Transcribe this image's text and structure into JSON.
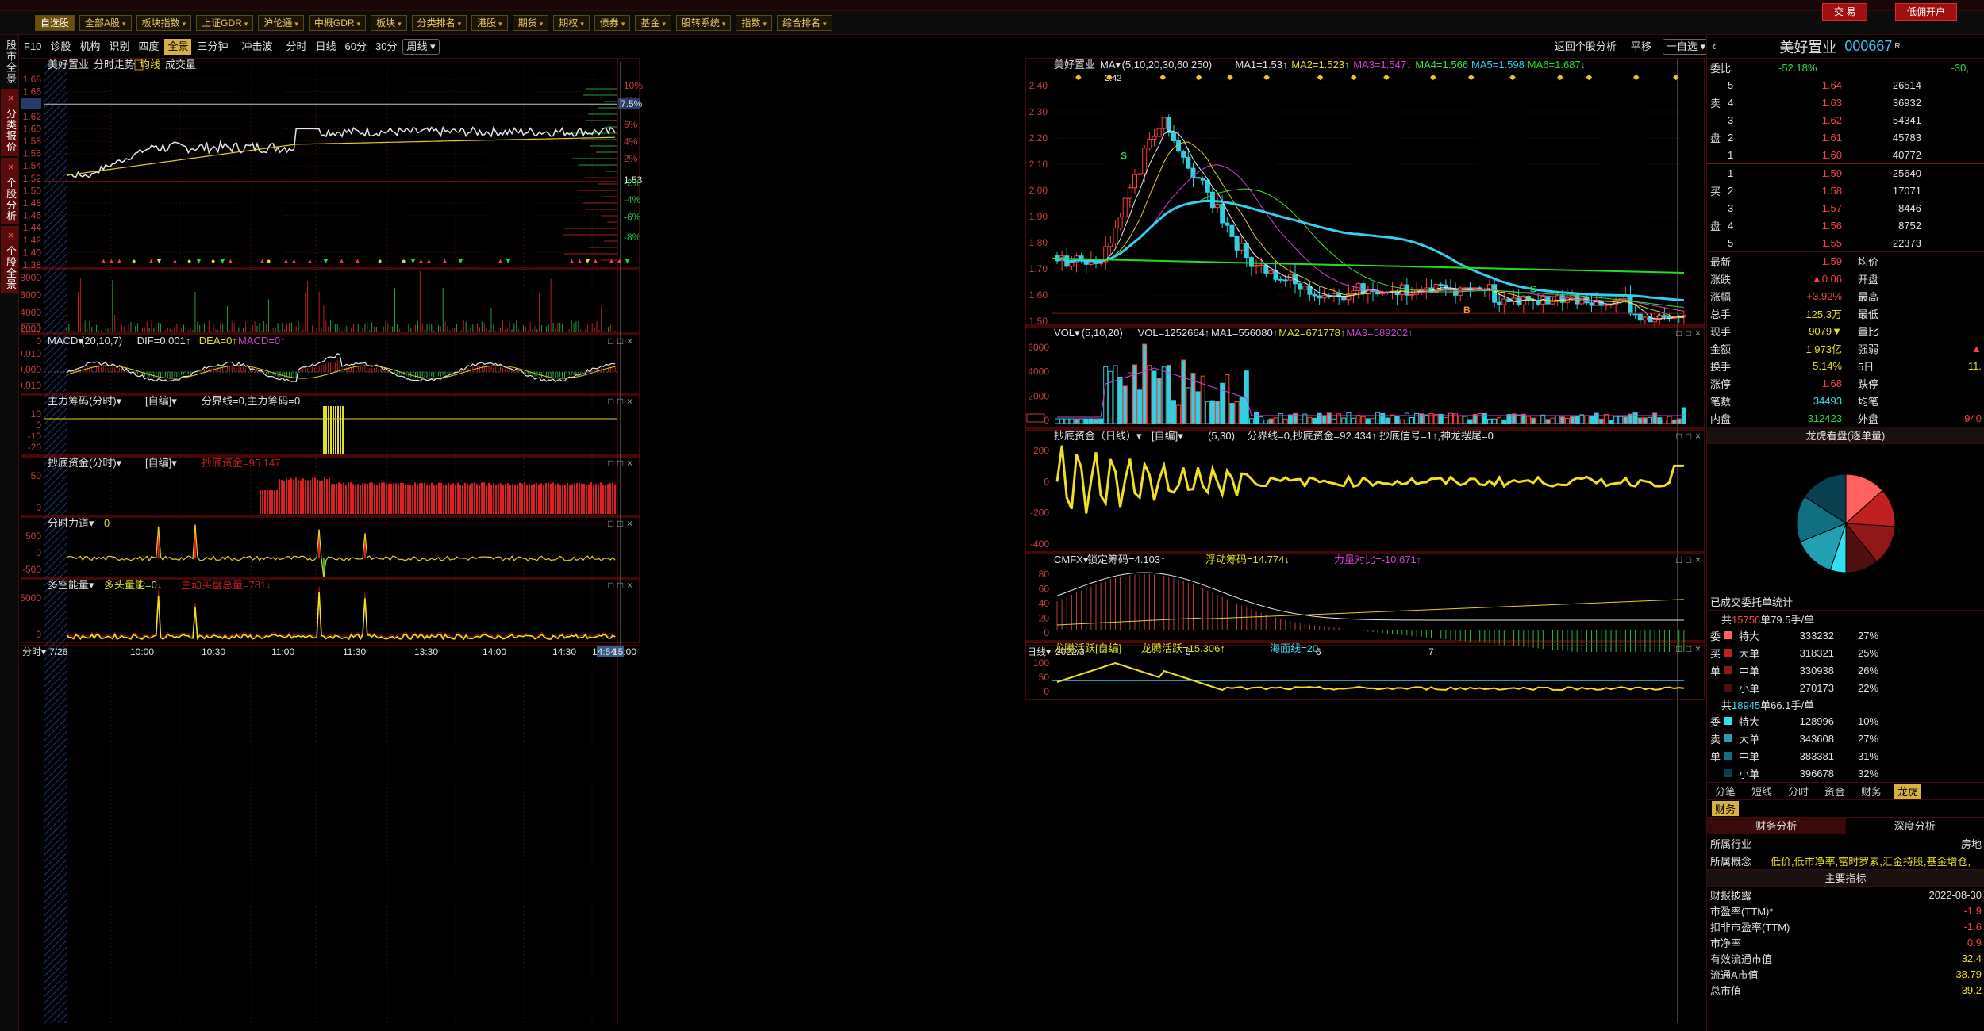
{
  "toolbar": {
    "buttons": [
      {
        "label": "自选股",
        "active": true
      },
      {
        "label": "全部A股",
        "dd": true
      },
      {
        "label": "板块指数",
        "dd": true
      },
      {
        "label": "上证GDR",
        "dd": true
      },
      {
        "label": "沪伦通",
        "dd": true
      },
      {
        "label": "中概GDR",
        "dd": true
      },
      {
        "label": "板块",
        "dd": true
      },
      {
        "label": "分类排名",
        "dd": true
      },
      {
        "label": "港股",
        "dd": true
      },
      {
        "label": "期货",
        "dd": true
      },
      {
        "label": "期权",
        "dd": true
      },
      {
        "label": "债券",
        "dd": true
      },
      {
        "label": "基金",
        "dd": true
      },
      {
        "label": "股转系统",
        "dd": true
      },
      {
        "label": "指数",
        "dd": true
      },
      {
        "label": "综合排名",
        "dd": true
      }
    ],
    "trade_button": "交 易",
    "open_account_button": "低佣开户"
  },
  "sidebar": {
    "tabs": [
      {
        "label": "股市全景",
        "active": false
      },
      {
        "label": "分类报价",
        "active": true
      },
      {
        "label": "个股分析",
        "active": true
      },
      {
        "label": "个股全景",
        "active": true
      }
    ]
  },
  "subbar": {
    "left": [
      "F10",
      "诊股",
      "机构",
      "识别",
      "四度",
      "全景",
      "三分钟",
      "冲击波",
      "分时",
      "日线",
      "60分",
      "30分",
      "周线"
    ],
    "active": "全景",
    "right": [
      "返回个股分析",
      "平移",
      "一自选"
    ]
  },
  "intraday": {
    "header": {
      "name": "美好置业",
      "t1": "分时走势",
      "t2": "均线",
      "t3": "成交量"
    },
    "price_ticks": [
      "1.68",
      "1.66",
      "1.64",
      "1.62",
      "1.60",
      "1.58",
      "1.56",
      "1.54",
      "1.52",
      "1.50",
      "1.48",
      "1.46",
      "1.44",
      "1.42",
      "1.40",
      "1.38"
    ],
    "pct_ticks": [
      "10%",
      "8%",
      "6%",
      "4%",
      "2%",
      "-2%",
      "-4%",
      "-6%",
      "-8%"
    ],
    "highlight_price": "1.64",
    "highlight_pct": "7.5%",
    "ref_price": "1.53",
    "vol_ticks": [
      "8000",
      "6000",
      "4000",
      "2000",
      "0"
    ],
    "vol_unit": "万",
    "macd": {
      "title": "MACD",
      "params": "(20,10,7)",
      "dif": "DIF=0.001↑",
      "dea": "DEA=0↑",
      "macd": "MACD=0↑",
      "ticks": [
        "0.010",
        "0.000",
        "-0.010"
      ]
    },
    "zl": {
      "title": "主力筹码(分时)",
      "custom": "[自编]",
      "txt": "分界线=0,主力筹码=0",
      "ticks": [
        "10",
        "0",
        "-10",
        "-20"
      ]
    },
    "cd": {
      "title": "抄底资金(分时)",
      "custom": "[自编]",
      "txt": "抄底资金=95.147",
      "ticks": [
        "50",
        "0"
      ]
    },
    "fs": {
      "title": "分时力道",
      "txt": "0",
      "ticks": [
        "500",
        "0",
        "-500"
      ]
    },
    "dk": {
      "title": "多空能量",
      "txt1": "多头量能=0↓",
      "txt2": "主动买盘总量=781↓",
      "ticks": [
        "5000",
        "0"
      ]
    },
    "time_axis": [
      "7/26",
      "10:00",
      "10:30",
      "11:00",
      "11:30",
      "13:30",
      "14:00",
      "14:30",
      "14:54",
      "15:00"
    ],
    "period_label": "分时"
  },
  "kline": {
    "header": {
      "name": "美好置业",
      "ma": "MA",
      "params": "(5,10,20,30,60,250)",
      "ma1": "MA1=1.53↑",
      "ma2": "MA2=1.523↑",
      "ma3": "MA3=1.547↓",
      "ma4": "MA4=1.566",
      "ma5": "MA5=1.598",
      "ma6": "MA6=1.687↓"
    },
    "price_ticks": [
      "2.40",
      "2.30",
      "2.20",
      "2.10",
      "2.00",
      "1.90",
      "1.80",
      "1.70",
      "1.60",
      "1.50"
    ],
    "high_label": "2.42",
    "low_label": "1.44",
    "vol": {
      "title": "VOL",
      "params": "(5,10,20)",
      "v": "VOL=1252664↑",
      "ma1": "MA1=556080↑",
      "ma2": "MA2=671778↑",
      "ma3": "MA3=589202↑",
      "ticks": [
        "6000",
        "4000",
        "2000",
        "0"
      ],
      "unit": "万"
    },
    "cd": {
      "title": "抄底资金（日线）",
      "custom": "[自编]",
      "params": "(5,30)",
      "txt": "分界线=0,抄底资金=92.434↑,抄底信号=1↑,神龙摆尾=0",
      "ticks": [
        "200",
        "0",
        "-200",
        "-400"
      ]
    },
    "cmfx": {
      "title": "CMFX",
      "t1": "锁定筹码=4.103↑",
      "t2": "浮动筹码=14.774↓",
      "t3": "力量对比=-10.671↑",
      "ticks": [
        "80",
        "60",
        "40",
        "20",
        "0"
      ]
    },
    "lt": {
      "title": "龙腾活跃[自编]",
      "t1": "龙腾活跃=15.306↑",
      "t2": "海面线=20",
      "ticks": [
        "100",
        "50",
        "0"
      ]
    },
    "time_axis": [
      "2022/3",
      "4",
      "5",
      "6",
      "7"
    ],
    "period_label": "日线"
  },
  "quote": {
    "name": "美好置业",
    "code": "000667",
    "flag": "R",
    "weibi": {
      "label": "委比",
      "v1": "-52.18%",
      "v2": "-30,"
    },
    "sells": [
      {
        "n": "5",
        "p": "1.64",
        "v": "26514"
      },
      {
        "n": "4",
        "p": "1.63",
        "v": "36932"
      },
      {
        "n": "3",
        "p": "1.62",
        "v": "54341"
      },
      {
        "n": "2",
        "p": "1.61",
        "v": "45783"
      },
      {
        "n": "1",
        "p": "1.60",
        "v": "40772"
      }
    ],
    "buys": [
      {
        "n": "1",
        "p": "1.59",
        "v": "25640"
      },
      {
        "n": "2",
        "p": "1.58",
        "v": "17071"
      },
      {
        "n": "3",
        "p": "1.57",
        "v": "8446"
      },
      {
        "n": "4",
        "p": "1.56",
        "v": "8752"
      },
      {
        "n": "5",
        "p": "1.55",
        "v": "22373"
      }
    ],
    "sell_side": "卖盘",
    "buy_side": "买盘",
    "stats": [
      {
        "k1": "最新",
        "v1": "1.59",
        "c1": "red",
        "k2": "均价",
        "v2": "",
        "c2": "red"
      },
      {
        "k1": "涨跌",
        "v1": "▲0.06",
        "c1": "red",
        "k2": "开盘",
        "v2": "",
        "c2": "red"
      },
      {
        "k1": "涨幅",
        "v1": "+3.92%",
        "c1": "red",
        "k2": "最高",
        "v2": "",
        "c2": "red"
      },
      {
        "k1": "总手",
        "v1": "125.3万",
        "c1": "yel",
        "k2": "最低",
        "v2": "",
        "c2": "red"
      },
      {
        "k1": "现手",
        "v1": "9079▼",
        "c1": "yel",
        "k2": "量比",
        "v2": "",
        "c2": "wht"
      },
      {
        "k1": "金额",
        "v1": "1.973亿",
        "c1": "yel",
        "k2": "强弱",
        "v2": "▲",
        "c2": "red"
      },
      {
        "k1": "换手",
        "v1": "5.14%",
        "c1": "yel",
        "k2": "5日",
        "v2": "11.",
        "c2": "yel"
      },
      {
        "k1": "涨停",
        "v1": "1.68",
        "c1": "red",
        "k2": "跌停",
        "v2": "",
        "c2": "grn"
      },
      {
        "k1": "笔数",
        "v1": "34493",
        "c1": "cyan",
        "k2": "均笔",
        "v2": "",
        "c2": "wht"
      },
      {
        "k1": "内盘",
        "v1": "312423",
        "c1": "grn",
        "k2": "外盘",
        "v2": "940",
        "c2": "red"
      }
    ],
    "lhtitle": "龙虎看盘(逐单量)",
    "tradestat": "已成交委托单统计",
    "buy_group": {
      "head1": "共",
      "count": "15756",
      "head2": "单79.5手/单",
      "side": [
        "委",
        "买",
        "单"
      ],
      "rows": [
        {
          "k": "特大",
          "v": "333232",
          "p": "27%",
          "color": "#ff6060"
        },
        {
          "k": "大单",
          "v": "318321",
          "p": "25%",
          "color": "#c02020"
        },
        {
          "k": "中单",
          "v": "330938",
          "p": "26%",
          "color": "#901818"
        },
        {
          "k": "小单",
          "v": "270173",
          "p": "22%",
          "color": "#501010"
        }
      ]
    },
    "sell_group": {
      "head1": "共",
      "count": "18945",
      "head2": "单66.1手/单",
      "side": [
        "委",
        "卖",
        "单"
      ],
      "rows": [
        {
          "k": "特大",
          "v": "128996",
          "p": "10%",
          "color": "#30e0f0"
        },
        {
          "k": "大单",
          "v": "343608",
          "p": "27%",
          "color": "#20a0b0"
        },
        {
          "k": "中单",
          "v": "383381",
          "p": "31%",
          "color": "#107080"
        },
        {
          "k": "小单",
          "v": "396678",
          "p": "32%",
          "color": "#084050"
        }
      ]
    },
    "bottom_tabs": [
      "分笔",
      "短线",
      "分时",
      "资金",
      "财务",
      "龙虎"
    ],
    "bottom_active": "龙虎",
    "fin_tab": "财务",
    "fin_tabs": [
      "财务分析",
      "深度分析"
    ],
    "industry": {
      "k": "所属行业",
      "v": "房地"
    },
    "concept": {
      "k": "所属概念",
      "v": "低价,低市净率,富时罗素,汇金持股,基金增仓,"
    },
    "main_ind": "主要指标",
    "fin_rows": [
      {
        "k": "财报披露",
        "v": "2022-08-30",
        "c": "wht"
      },
      {
        "k": "市盈率(TTM)*",
        "v": "-1.9",
        "c": "red"
      },
      {
        "k": "扣非市盈率(TTM)",
        "v": "-1.6",
        "c": "red"
      },
      {
        "k": "市净率",
        "v": "0.9",
        "c": "red"
      },
      {
        "k": "有效流通市值",
        "v": "32.4",
        "c": "yel"
      },
      {
        "k": "流通A市值",
        "v": "38.79",
        "c": "yel"
      },
      {
        "k": "总市值",
        "v": "39.2",
        "c": "yel"
      }
    ]
  }
}
